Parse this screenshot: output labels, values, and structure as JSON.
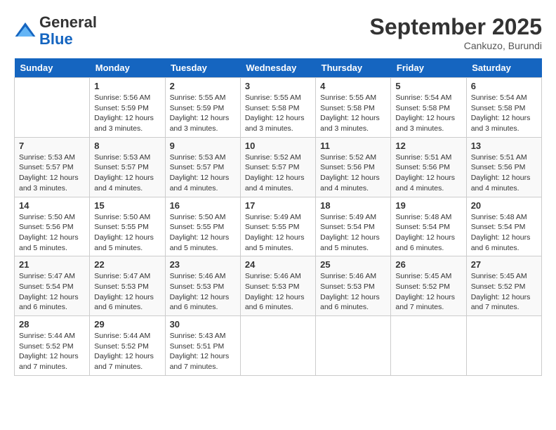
{
  "header": {
    "logo": {
      "general": "General",
      "blue": "Blue"
    },
    "month": "September 2025",
    "location": "Cankuzo, Burundi"
  },
  "days_of_week": [
    "Sunday",
    "Monday",
    "Tuesday",
    "Wednesday",
    "Thursday",
    "Friday",
    "Saturday"
  ],
  "weeks": [
    [
      {
        "day": "",
        "sunrise": "",
        "sunset": "",
        "daylight": ""
      },
      {
        "day": "1",
        "sunrise": "Sunrise: 5:56 AM",
        "sunset": "Sunset: 5:59 PM",
        "daylight": "Daylight: 12 hours and 3 minutes."
      },
      {
        "day": "2",
        "sunrise": "Sunrise: 5:55 AM",
        "sunset": "Sunset: 5:59 PM",
        "daylight": "Daylight: 12 hours and 3 minutes."
      },
      {
        "day": "3",
        "sunrise": "Sunrise: 5:55 AM",
        "sunset": "Sunset: 5:58 PM",
        "daylight": "Daylight: 12 hours and 3 minutes."
      },
      {
        "day": "4",
        "sunrise": "Sunrise: 5:55 AM",
        "sunset": "Sunset: 5:58 PM",
        "daylight": "Daylight: 12 hours and 3 minutes."
      },
      {
        "day": "5",
        "sunrise": "Sunrise: 5:54 AM",
        "sunset": "Sunset: 5:58 PM",
        "daylight": "Daylight: 12 hours and 3 minutes."
      },
      {
        "day": "6",
        "sunrise": "Sunrise: 5:54 AM",
        "sunset": "Sunset: 5:58 PM",
        "daylight": "Daylight: 12 hours and 3 minutes."
      }
    ],
    [
      {
        "day": "7",
        "sunrise": "Sunrise: 5:53 AM",
        "sunset": "Sunset: 5:57 PM",
        "daylight": "Daylight: 12 hours and 3 minutes."
      },
      {
        "day": "8",
        "sunrise": "Sunrise: 5:53 AM",
        "sunset": "Sunset: 5:57 PM",
        "daylight": "Daylight: 12 hours and 4 minutes."
      },
      {
        "day": "9",
        "sunrise": "Sunrise: 5:53 AM",
        "sunset": "Sunset: 5:57 PM",
        "daylight": "Daylight: 12 hours and 4 minutes."
      },
      {
        "day": "10",
        "sunrise": "Sunrise: 5:52 AM",
        "sunset": "Sunset: 5:57 PM",
        "daylight": "Daylight: 12 hours and 4 minutes."
      },
      {
        "day": "11",
        "sunrise": "Sunrise: 5:52 AM",
        "sunset": "Sunset: 5:56 PM",
        "daylight": "Daylight: 12 hours and 4 minutes."
      },
      {
        "day": "12",
        "sunrise": "Sunrise: 5:51 AM",
        "sunset": "Sunset: 5:56 PM",
        "daylight": "Daylight: 12 hours and 4 minutes."
      },
      {
        "day": "13",
        "sunrise": "Sunrise: 5:51 AM",
        "sunset": "Sunset: 5:56 PM",
        "daylight": "Daylight: 12 hours and 4 minutes."
      }
    ],
    [
      {
        "day": "14",
        "sunrise": "Sunrise: 5:50 AM",
        "sunset": "Sunset: 5:56 PM",
        "daylight": "Daylight: 12 hours and 5 minutes."
      },
      {
        "day": "15",
        "sunrise": "Sunrise: 5:50 AM",
        "sunset": "Sunset: 5:55 PM",
        "daylight": "Daylight: 12 hours and 5 minutes."
      },
      {
        "day": "16",
        "sunrise": "Sunrise: 5:50 AM",
        "sunset": "Sunset: 5:55 PM",
        "daylight": "Daylight: 12 hours and 5 minutes."
      },
      {
        "day": "17",
        "sunrise": "Sunrise: 5:49 AM",
        "sunset": "Sunset: 5:55 PM",
        "daylight": "Daylight: 12 hours and 5 minutes."
      },
      {
        "day": "18",
        "sunrise": "Sunrise: 5:49 AM",
        "sunset": "Sunset: 5:54 PM",
        "daylight": "Daylight: 12 hours and 5 minutes."
      },
      {
        "day": "19",
        "sunrise": "Sunrise: 5:48 AM",
        "sunset": "Sunset: 5:54 PM",
        "daylight": "Daylight: 12 hours and 6 minutes."
      },
      {
        "day": "20",
        "sunrise": "Sunrise: 5:48 AM",
        "sunset": "Sunset: 5:54 PM",
        "daylight": "Daylight: 12 hours and 6 minutes."
      }
    ],
    [
      {
        "day": "21",
        "sunrise": "Sunrise: 5:47 AM",
        "sunset": "Sunset: 5:54 PM",
        "daylight": "Daylight: 12 hours and 6 minutes."
      },
      {
        "day": "22",
        "sunrise": "Sunrise: 5:47 AM",
        "sunset": "Sunset: 5:53 PM",
        "daylight": "Daylight: 12 hours and 6 minutes."
      },
      {
        "day": "23",
        "sunrise": "Sunrise: 5:46 AM",
        "sunset": "Sunset: 5:53 PM",
        "daylight": "Daylight: 12 hours and 6 minutes."
      },
      {
        "day": "24",
        "sunrise": "Sunrise: 5:46 AM",
        "sunset": "Sunset: 5:53 PM",
        "daylight": "Daylight: 12 hours and 6 minutes."
      },
      {
        "day": "25",
        "sunrise": "Sunrise: 5:46 AM",
        "sunset": "Sunset: 5:53 PM",
        "daylight": "Daylight: 12 hours and 6 minutes."
      },
      {
        "day": "26",
        "sunrise": "Sunrise: 5:45 AM",
        "sunset": "Sunset: 5:52 PM",
        "daylight": "Daylight: 12 hours and 7 minutes."
      },
      {
        "day": "27",
        "sunrise": "Sunrise: 5:45 AM",
        "sunset": "Sunset: 5:52 PM",
        "daylight": "Daylight: 12 hours and 7 minutes."
      }
    ],
    [
      {
        "day": "28",
        "sunrise": "Sunrise: 5:44 AM",
        "sunset": "Sunset: 5:52 PM",
        "daylight": "Daylight: 12 hours and 7 minutes."
      },
      {
        "day": "29",
        "sunrise": "Sunrise: 5:44 AM",
        "sunset": "Sunset: 5:52 PM",
        "daylight": "Daylight: 12 hours and 7 minutes."
      },
      {
        "day": "30",
        "sunrise": "Sunrise: 5:43 AM",
        "sunset": "Sunset: 5:51 PM",
        "daylight": "Daylight: 12 hours and 7 minutes."
      },
      {
        "day": "",
        "sunrise": "",
        "sunset": "",
        "daylight": ""
      },
      {
        "day": "",
        "sunrise": "",
        "sunset": "",
        "daylight": ""
      },
      {
        "day": "",
        "sunrise": "",
        "sunset": "",
        "daylight": ""
      },
      {
        "day": "",
        "sunrise": "",
        "sunset": "",
        "daylight": ""
      }
    ]
  ]
}
